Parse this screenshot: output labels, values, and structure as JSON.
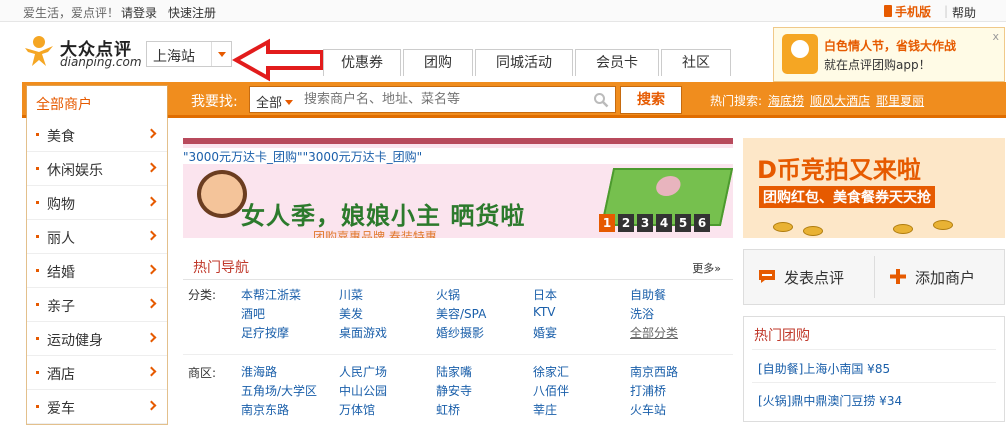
{
  "topbar": {
    "slogan": "爱生活，爱点评！",
    "login": "请登录",
    "register": "快速注册",
    "mobile": "手机版",
    "separator": "|",
    "help": "帮助"
  },
  "logo": {
    "cn": "大众点评",
    "en": "dianping.com"
  },
  "city": {
    "name": "上海站"
  },
  "tabs": [
    "优惠券",
    "团购",
    "同城活动",
    "会员卡",
    "社区"
  ],
  "promo": {
    "line1": "白色情人节，省钱大作战",
    "line2": "就在点评团购app！",
    "close": "x"
  },
  "nav": {
    "all_merchants": "全部商户",
    "find_label": "我要找:",
    "search_category": "全部",
    "search_placeholder": "搜索商户名、地址、菜名等",
    "search_button": "搜索",
    "hot_label": "热门搜索:",
    "hot_links": [
      "海底捞",
      "顺风大酒店",
      "耶里夏丽"
    ]
  },
  "sidebar": [
    "美食",
    "休闲娱乐",
    "购物",
    "丽人",
    "结婚",
    "亲子",
    "运动健身",
    "酒店",
    "爱车"
  ],
  "banner": {
    "caption": "\"3000元万达卡_团购\"\"3000元万达卡_团购\"",
    "headline": "女人季，娘娘小主 晒货啦",
    "sub": "团购嘉惠品牌 春装特惠",
    "pages": [
      "1",
      "2",
      "3",
      "4",
      "5",
      "6"
    ],
    "active_page": "1"
  },
  "side_banner": {
    "headline": "D币竞拍又来啦",
    "tagline": "团购红包、美食餐券天天抢"
  },
  "hot_nav": {
    "title": "热门导航",
    "more": "更多»",
    "category_label": "分类:",
    "categories": [
      [
        "本帮江浙菜",
        "川菜",
        "火锅",
        "日本",
        "自助餐"
      ],
      [
        "酒吧",
        "美发",
        "美容/SPA",
        "KTV",
        "洗浴"
      ],
      [
        "足疗按摩",
        "桌面游戏",
        "婚纱摄影",
        "婚宴",
        "全部分类"
      ]
    ],
    "district_label": "商区:",
    "districts": [
      [
        "淮海路",
        "人民广场",
        "陆家嘴",
        "徐家汇",
        "南京西路"
      ],
      [
        "五角场/大学区",
        "中山公园",
        "静安寺",
        "八佰伴",
        "打浦桥"
      ],
      [
        "南京东路",
        "万体馆",
        "虹桥",
        "莘庄",
        "火车站"
      ]
    ]
  },
  "actions": {
    "review": "发表点评",
    "add_shop": "添加商户"
  },
  "hot_tuan": {
    "title": "热门团购",
    "items": [
      "[自助餐]上海小南国 ¥85",
      "[火锅]鼎中鼎澳门豆捞 ¥34"
    ]
  },
  "colors": {
    "accent": "#f08d1e",
    "brand": "#e65a00",
    "link": "#1a5faa",
    "heading": "#c0392b"
  }
}
